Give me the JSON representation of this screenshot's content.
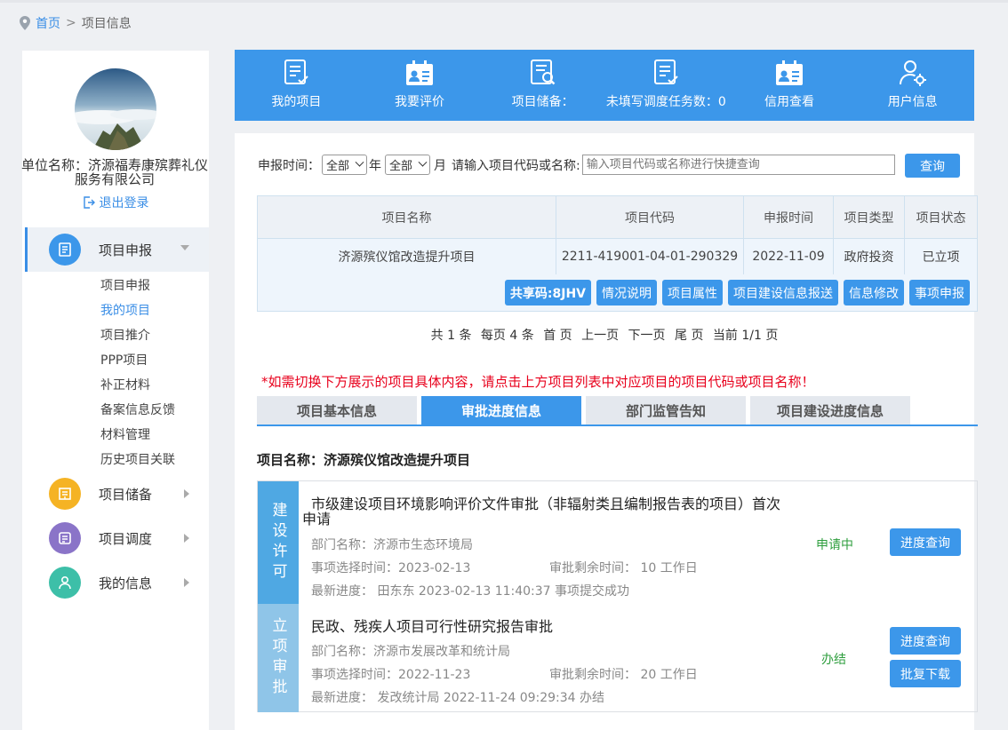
{
  "breadcrumb": {
    "home": "首页",
    "separator": ">",
    "current": "项目信息"
  },
  "sidebar": {
    "unit_name": "单位名称：济源福寿康殡葬礼仪服务有限公司",
    "logout": "退出登录",
    "menus": [
      {
        "label": "项目申报",
        "icon": "document-icon",
        "color": "#3c97ea"
      },
      {
        "label": "项目储备",
        "icon": "archive-icon",
        "color": "#f5b324"
      },
      {
        "label": "项目调度",
        "icon": "list-icon",
        "color": "#8a74c8"
      },
      {
        "label": "我的信息",
        "icon": "user-icon",
        "color": "#3dbfa8"
      }
    ],
    "submenu": [
      "项目申报",
      "我的项目",
      "项目推介",
      "PPP项目",
      "补正材料",
      "备案信息反馈",
      "材料管理",
      "历史项目关联"
    ],
    "active_sub": "我的项目"
  },
  "banner": [
    {
      "label": "我的项目",
      "icon": "document-check-icon"
    },
    {
      "label": "我要评价",
      "icon": "id-card-icon"
    },
    {
      "label": "项目储备：",
      "icon": "document-search-icon"
    },
    {
      "label": "未填写调度任务数：0",
      "icon": "task-list-icon"
    },
    {
      "label": "信用查看",
      "icon": "credit-card-icon"
    },
    {
      "label": "用户信息",
      "icon": "user-settings-icon"
    }
  ],
  "filter": {
    "time_label": "申报时间：",
    "year_value": "全部",
    "year_unit": "年",
    "month_value": "全部",
    "month_unit": "月",
    "search_label": "请输入项目代码或名称:",
    "search_placeholder": "输入项目代码或名称进行快捷查询",
    "query_button": "查询"
  },
  "table": {
    "headers": [
      "项目名称",
      "项目代码",
      "申报时间",
      "项目类型",
      "项目状态"
    ],
    "rows": [
      {
        "name": "济源殡仪馆改造提升项目",
        "code": "2211-419001-04-01-290329",
        "date": "2022-11-09",
        "type": "政府投资",
        "status": "已立项"
      }
    ],
    "row_buttons": [
      "共享码:8JHV",
      "情况说明",
      "项目属性",
      "项目建设信息报送",
      "信息修改",
      "事项申报"
    ]
  },
  "pager": {
    "total": "共 1 条",
    "per_page": "每页 4 条",
    "first": "首 页",
    "prev": "上一页",
    "next": "下一页",
    "last": "尾 页",
    "current": "当前 1/1 页"
  },
  "notice": "*如需切换下方展示的项目具体内容，请点击上方项目列表中对应项目的项目代码或项目名称！",
  "tabs": [
    "项目基本信息",
    "审批进度信息",
    "部门监管告知",
    "项目建设进度信息"
  ],
  "active_tab": "审批进度信息",
  "project_name": "项目名称：济源殡仪馆改造提升项目",
  "approvals": [
    {
      "category": "建设许可",
      "title": "市级建设项目环境影响评价文件审批（非辐射类且编制报告表的项目）首次申请",
      "dept": "部门名称：济源市生态环境局",
      "select_time": "事项选择时间：2023-02-13",
      "remain": "审批剩余时间： 10 工作日",
      "latest": "最新进度： 田东东 2023-02-13 11:40:37 事项提交成功",
      "status": "申请中",
      "status_color": "#2e9e3e",
      "buttons": [
        "进度查询"
      ]
    },
    {
      "category": "立项审批",
      "title": "民政、残疾人项目可行性研究报告审批",
      "dept": "部门名称：济源市发展改革和统计局",
      "select_time": "事项选择时间：2022-11-23",
      "remain": "审批剩余时间： 20 工作日",
      "latest": "最新进度： 发改统计局 2022-11-24 09:29:34 办结",
      "status": "办结",
      "status_color": "#2e9e3e",
      "buttons": [
        "进度查询",
        "批复下载"
      ]
    }
  ]
}
